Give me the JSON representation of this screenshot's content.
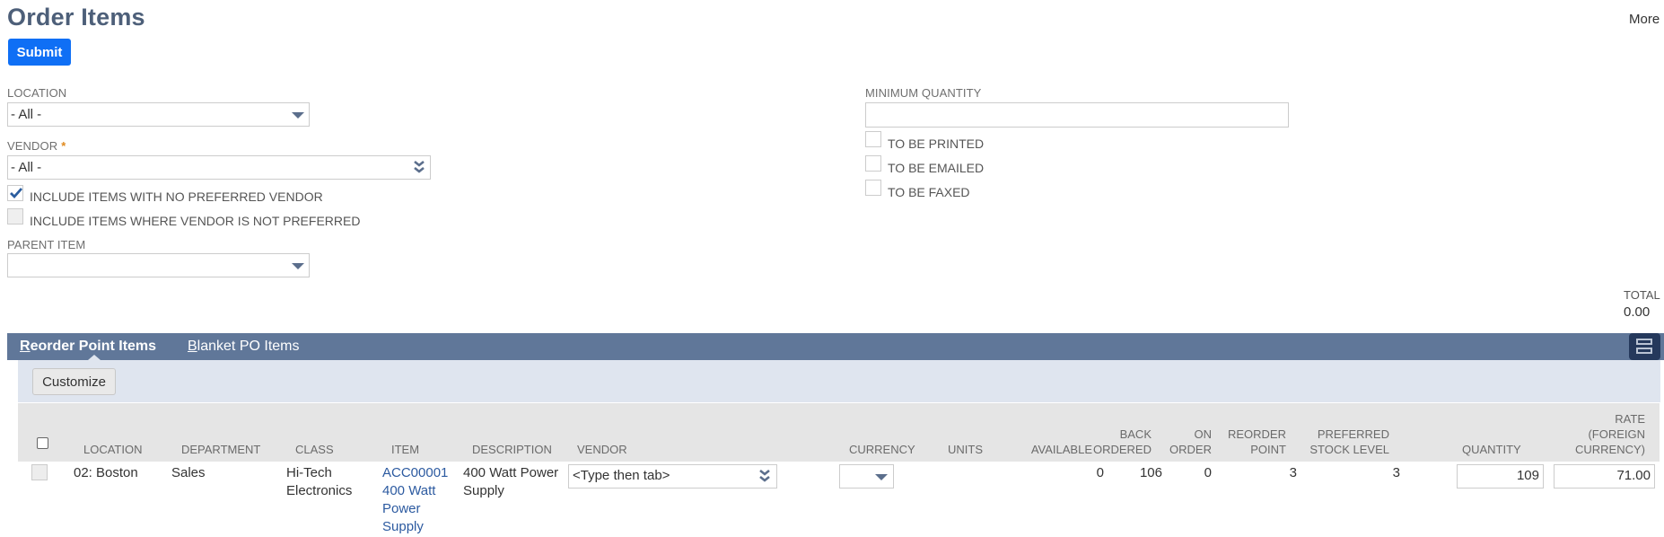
{
  "header": {
    "title": "Order Items",
    "more_label": "More",
    "submit_label": "Submit"
  },
  "filters": {
    "location": {
      "label": "LOCATION",
      "value": "- All -"
    },
    "vendor": {
      "label": "VENDOR",
      "required_mark": "*",
      "value": "- All -"
    },
    "include_no_preferred": {
      "label": "INCLUDE ITEMS WITH NO PREFERRED VENDOR",
      "checked": true
    },
    "include_not_preferred": {
      "label": "INCLUDE ITEMS WHERE VENDOR IS NOT PREFERRED",
      "checked": false,
      "disabled": true
    },
    "parent_item": {
      "label": "PARENT ITEM",
      "value": ""
    },
    "minimum_quantity": {
      "label": "MINIMUM QUANTITY",
      "value": ""
    },
    "to_be_printed": {
      "label": "TO BE PRINTED",
      "checked": false
    },
    "to_be_emailed": {
      "label": "TO BE EMAILED",
      "checked": false
    },
    "to_be_faxed": {
      "label": "TO BE FAXED",
      "checked": false
    }
  },
  "total": {
    "label": "TOTAL",
    "value": "0.00"
  },
  "tabs": [
    {
      "access_key": "R",
      "rest": "eorder Point Items",
      "active": true
    },
    {
      "access_key": "B",
      "rest": "lanket PO Items",
      "active": false
    }
  ],
  "sublist": {
    "customize_label": "Customize",
    "layout_icon": "layout-toggle-icon",
    "columns": [
      {
        "key": "location",
        "label": "LOCATION"
      },
      {
        "key": "department",
        "label": "DEPARTMENT"
      },
      {
        "key": "class",
        "label": "CLASS"
      },
      {
        "key": "item",
        "label": "ITEM"
      },
      {
        "key": "description",
        "label": "DESCRIPTION"
      },
      {
        "key": "vendor",
        "label": "VENDOR"
      },
      {
        "key": "currency",
        "label": "CURRENCY"
      },
      {
        "key": "units",
        "label": "UNITS"
      },
      {
        "key": "available",
        "label": "AVAILABLE"
      },
      {
        "key": "back_ordered",
        "label_line1": "BACK",
        "label_line2": "ORDERED"
      },
      {
        "key": "on_order",
        "label_line1": "ON",
        "label_line2": "ORDER"
      },
      {
        "key": "reorder_point",
        "label_line1": "REORDER",
        "label_line2": "POINT"
      },
      {
        "key": "preferred_stock_level",
        "label_line1": "PREFERRED",
        "label_line2": "STOCK LEVEL"
      },
      {
        "key": "quantity",
        "label": "QUANTITY"
      },
      {
        "key": "rate",
        "label_line1": "RATE",
        "label_line2": "(FOREIGN",
        "label_line3": "CURRENCY)"
      }
    ],
    "rows": [
      {
        "selected": false,
        "location": "02: Boston",
        "department": "Sales",
        "class_line1": "Hi-Tech",
        "class_line2": "Electronics",
        "item_line1": "ACC00001",
        "item_line2": "400 Watt",
        "item_line3": "Power",
        "item_line4": "Supply",
        "description_line1": "400 Watt Power",
        "description_line2": "Supply",
        "vendor_placeholder": "<Type then tab>",
        "currency": "",
        "units": "",
        "available": "0",
        "back_ordered": "106",
        "on_order": "0",
        "reorder_point": "3",
        "preferred_stock_level": "3",
        "quantity": "109",
        "rate": "71.00"
      }
    ]
  },
  "colors": {
    "title": "#4d5f79",
    "primary_button": "#0f6ff5",
    "tab_bar": "#607799",
    "tab_band": "#dfe5ef",
    "header_band": "#e5e5e5",
    "link": "#2c5aa0",
    "required": "#e08a1e"
  }
}
